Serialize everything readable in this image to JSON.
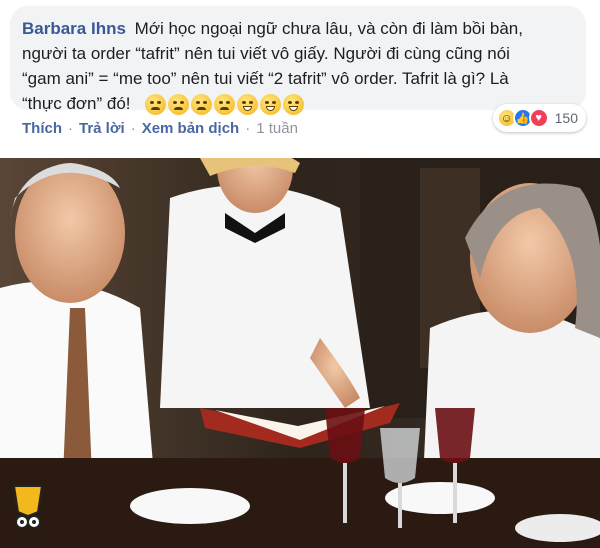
{
  "comment": {
    "author": "Barbara Ihns",
    "text": "Mới học ngoại ngữ chưa lâu, và còn đi làm bồi bàn, người ta order “tafrit” nên tui viết vô giấy. Người đi cùng cũng nói “gam ani” = “me too” nên tui viết “2 tafrit” vô order. Tafrit là gì? Là “thực đơn” đó!",
    "emojis": [
      "rolling-eyes",
      "rolling-eyes",
      "persevering",
      "persevering",
      "laughing",
      "laughing",
      "laughing"
    ]
  },
  "reactions": {
    "icons": [
      "haha-icon",
      "like-icon",
      "love-icon"
    ],
    "count": "150"
  },
  "actions": {
    "like": "Thích",
    "reply": "Trả lời",
    "translate": "Xem bản dịch",
    "time": "1 tuần",
    "separator": "·"
  },
  "photo": {
    "subject": "restaurant-scene"
  }
}
